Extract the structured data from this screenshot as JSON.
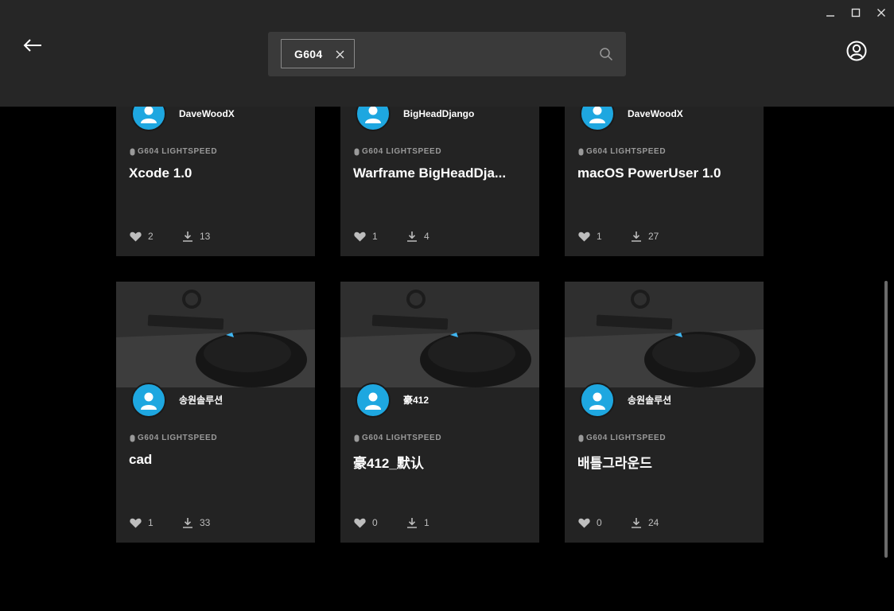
{
  "window": {
    "controls": [
      "minimize",
      "maximize",
      "close"
    ]
  },
  "search": {
    "chip_label": "G604",
    "placeholder": ""
  },
  "colors": {
    "header_bg": "#262626",
    "card_bg": "#232323",
    "avatar_bg": "#1ea7e0"
  },
  "cards": [
    {
      "author": "DaveWoodX",
      "device": "G604 LIGHTSPEED",
      "title": "Xcode 1.0",
      "likes": "2",
      "downloads": "13"
    },
    {
      "author": "BigHeadDjango",
      "device": "G604 LIGHTSPEED",
      "title": "Warframe BigHeadDja...",
      "likes": "1",
      "downloads": "4"
    },
    {
      "author": "DaveWoodX",
      "device": "G604 LIGHTSPEED",
      "title": "macOS PowerUser 1.0",
      "likes": "1",
      "downloads": "27"
    },
    {
      "author": "송원솔루션",
      "device": "G604 LIGHTSPEED",
      "title": "cad",
      "likes": "1",
      "downloads": "33"
    },
    {
      "author": "豪412",
      "device": "G604 LIGHTSPEED",
      "title": "豪412_默认",
      "likes": "0",
      "downloads": "1"
    },
    {
      "author": "송원솔루션",
      "device": "G604 LIGHTSPEED",
      "title": "배틀그라운드",
      "likes": "0",
      "downloads": "24"
    }
  ]
}
